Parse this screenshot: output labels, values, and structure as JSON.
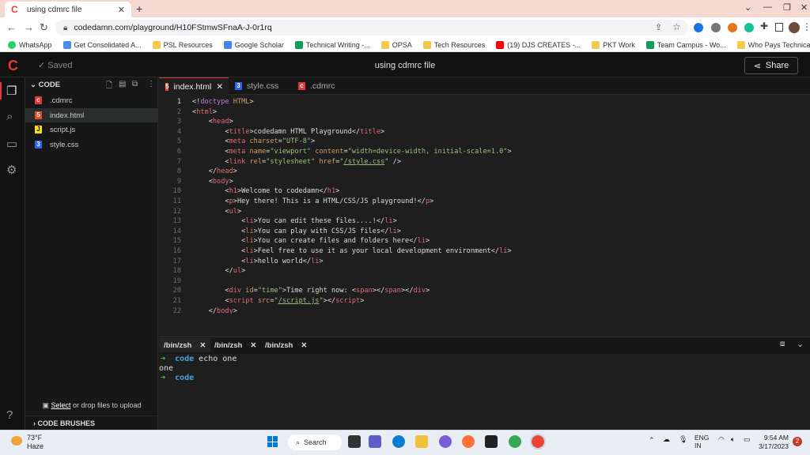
{
  "browser": {
    "tab_title": "using cdmrc file",
    "url": "codedamn.com/playground/H10FStmwSFnaA-J-0r1rq",
    "bookmarks": [
      "WhatsApp",
      "Get Consolidated A...",
      "PSL Resources",
      "Google Scholar",
      "Technical Writing -...",
      "OPSA",
      "Tech Resources",
      "(19) DJS CREATES -...",
      "PKT Work",
      "Team Campus - Wo...",
      "Who Pays Technical..."
    ]
  },
  "app": {
    "logo": "C",
    "saved_label": "Saved",
    "title": "using cdmrc file",
    "share_label": "Share"
  },
  "explorer": {
    "header": "CODE",
    "files": [
      ".cdmrc",
      "index.html",
      "script.js",
      "style.css"
    ],
    "upload_link": "Select",
    "upload_text": " or drop files to upload",
    "brushes": "CODE BRUSHES"
  },
  "editor": {
    "tabs": [
      "index.html",
      "style.css",
      ".cdmrc"
    ],
    "line_numbers": [
      "1",
      "2",
      "3",
      "4",
      "5",
      "6",
      "7",
      "8",
      "9",
      "10",
      "11",
      "12",
      "13",
      "14",
      "15",
      "16",
      "17",
      "18",
      "19",
      "20",
      "21",
      "22"
    ]
  },
  "terminal": {
    "tabs": [
      "/bin/zsh",
      "/bin/zsh",
      "/bin/zsh"
    ],
    "prompt_word": "code",
    "command": " echo one",
    "output": "one"
  },
  "taskbar": {
    "temperature": "73°F",
    "weather": "Haze",
    "search_label": "Search",
    "lang": "ENG",
    "region": "IN",
    "time": "9:54 AM",
    "date": "3/17/2023",
    "notif_count": "2"
  }
}
